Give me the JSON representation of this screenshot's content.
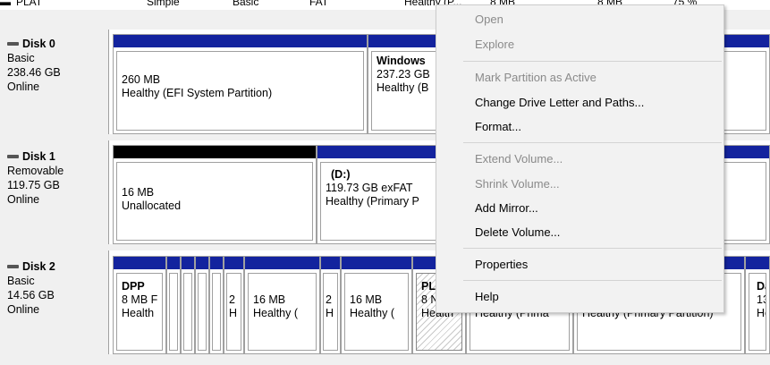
{
  "volume_row": {
    "name": "PLAT",
    "layout": "Simple",
    "type": "Basic",
    "fs": "FAT",
    "status": "Healthy (P...",
    "capacity": "8 MB",
    "free": "8 MB",
    "pct": "75 %"
  },
  "disks": [
    {
      "name": "Disk 0",
      "type": "Basic",
      "size": "238.46 GB",
      "state": "Online"
    },
    {
      "name": "Disk 1",
      "type": "Removable",
      "size": "119.75 GB",
      "state": "Online"
    },
    {
      "name": "Disk 2",
      "type": "Basic",
      "size": "14.56 GB",
      "state": "Online"
    }
  ],
  "disk0": {
    "p1": {
      "size": "260 MB",
      "status": "Healthy (EFI System Partition)"
    },
    "p2": {
      "title": "Windows",
      "size": "237.23 GB",
      "status": "Healthy (B"
    }
  },
  "disk1": {
    "p1": {
      "size": "16 MB",
      "status": "Unallocated"
    },
    "p2": {
      "title": "(D:)",
      "size": "119.73 GB exFAT",
      "status": "Healthy (Primary P"
    }
  },
  "disk2": {
    "dpp": {
      "title": "DPP",
      "size": "8 MB F",
      "status": "Health"
    },
    "s1": {
      "size": "2",
      "status": "H"
    },
    "p16a": {
      "size": "16 MB",
      "status": "Healthy ("
    },
    "s2": {
      "size": "2",
      "status": "H"
    },
    "p16b": {
      "size": "16 MB",
      "status": "Healthy ("
    },
    "plat": {
      "title": "PL",
      "size": "8 N",
      "status": "Health"
    },
    "pA": {
      "status": "Healthy (Prima"
    },
    "pB": {
      "status": "Healthy (Primary Partition)"
    },
    "pC": {
      "title": "Da",
      "size": "13.",
      "status": "He"
    }
  },
  "context_menu": {
    "open": "Open",
    "explore": "Explore",
    "mark_active": "Mark Partition as Active",
    "change_letter": "Change Drive Letter and Paths...",
    "format": "Format...",
    "extend": "Extend Volume...",
    "shrink": "Shrink Volume...",
    "add_mirror": "Add Mirror...",
    "delete": "Delete Volume...",
    "properties": "Properties",
    "help": "Help"
  },
  "colors": {
    "primary_bar": "#13239e",
    "unallocated_bar": "#000000",
    "menu_bg": "#f2f2f2",
    "disabled_text": "#8a8a8a"
  }
}
